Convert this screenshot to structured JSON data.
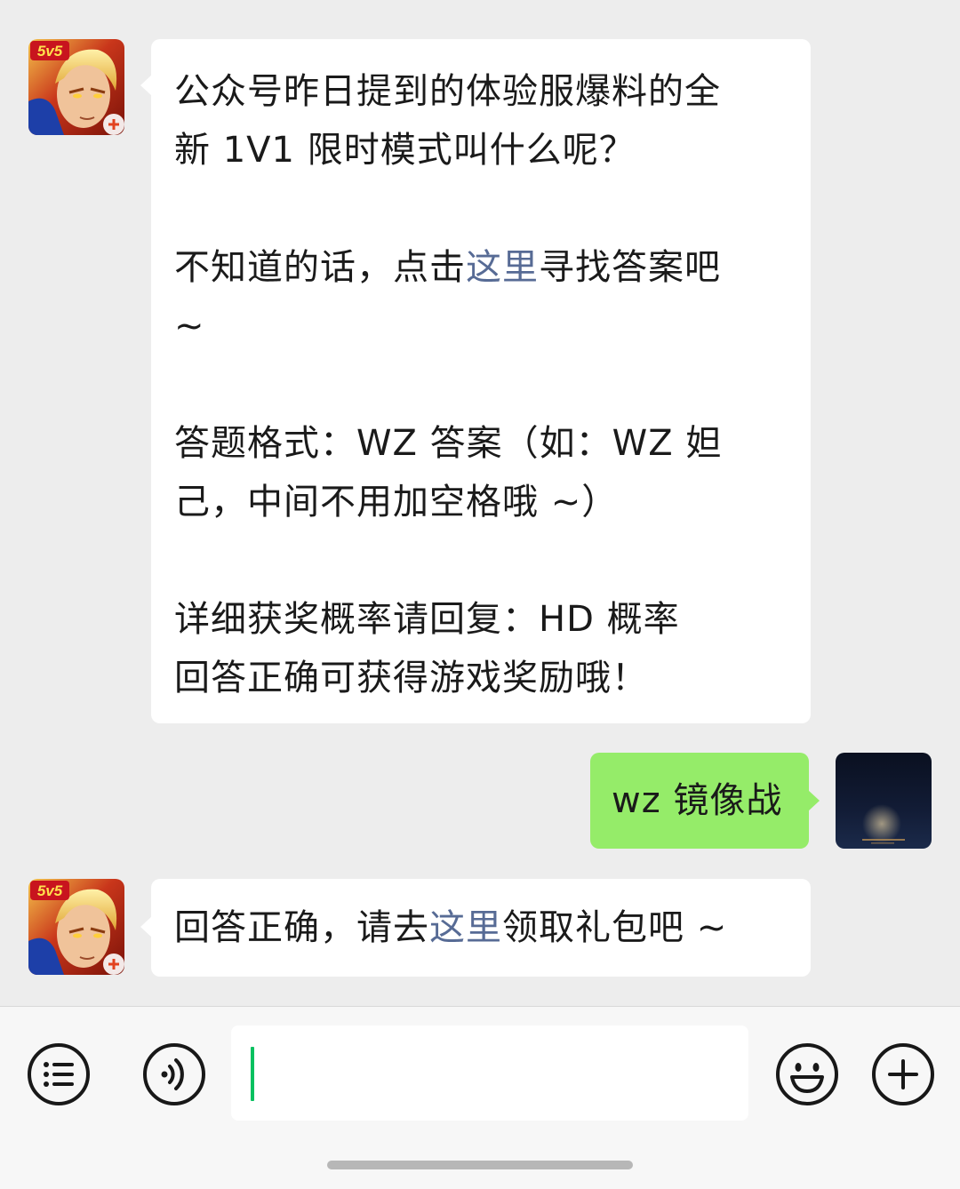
{
  "messages": [
    {
      "side": "left",
      "lines": [
        {
          "text": "公众号昨日提到的体验服爆料的全"
        },
        {
          "text": "新 1V1 限时模式叫什么呢？"
        },
        {
          "text": "",
          "blank": true
        },
        {
          "pre": "不知道的话，点击",
          "link": "这里",
          "post": "寻找答案吧"
        },
        {
          "text": "~"
        },
        {
          "text": "",
          "blank": true
        },
        {
          "text": "答题格式：WZ 答案（如：WZ 妲"
        },
        {
          "text": "己，中间不用加空格哦 ~）"
        },
        {
          "text": "",
          "blank": true
        },
        {
          "text": "详细获奖概率请回复：HD 概率"
        },
        {
          "text": "回答正确可获得游戏奖励哦！"
        }
      ]
    },
    {
      "side": "right",
      "text": "wz 镜像战"
    },
    {
      "side": "left",
      "pre": "回答正确，请去",
      "link": "这里",
      "post": "领取礼包吧 ~"
    }
  ],
  "avatar_badge": "5v5",
  "colors": {
    "background": "#ededed",
    "left_bubble": "#ffffff",
    "right_bubble": "#95ec69",
    "link": "#576b95",
    "caret": "#07c160"
  },
  "input_bar": {
    "value": "",
    "icons": [
      "menu-list-icon",
      "voice-icon",
      "emoji-icon",
      "plus-icon"
    ]
  }
}
